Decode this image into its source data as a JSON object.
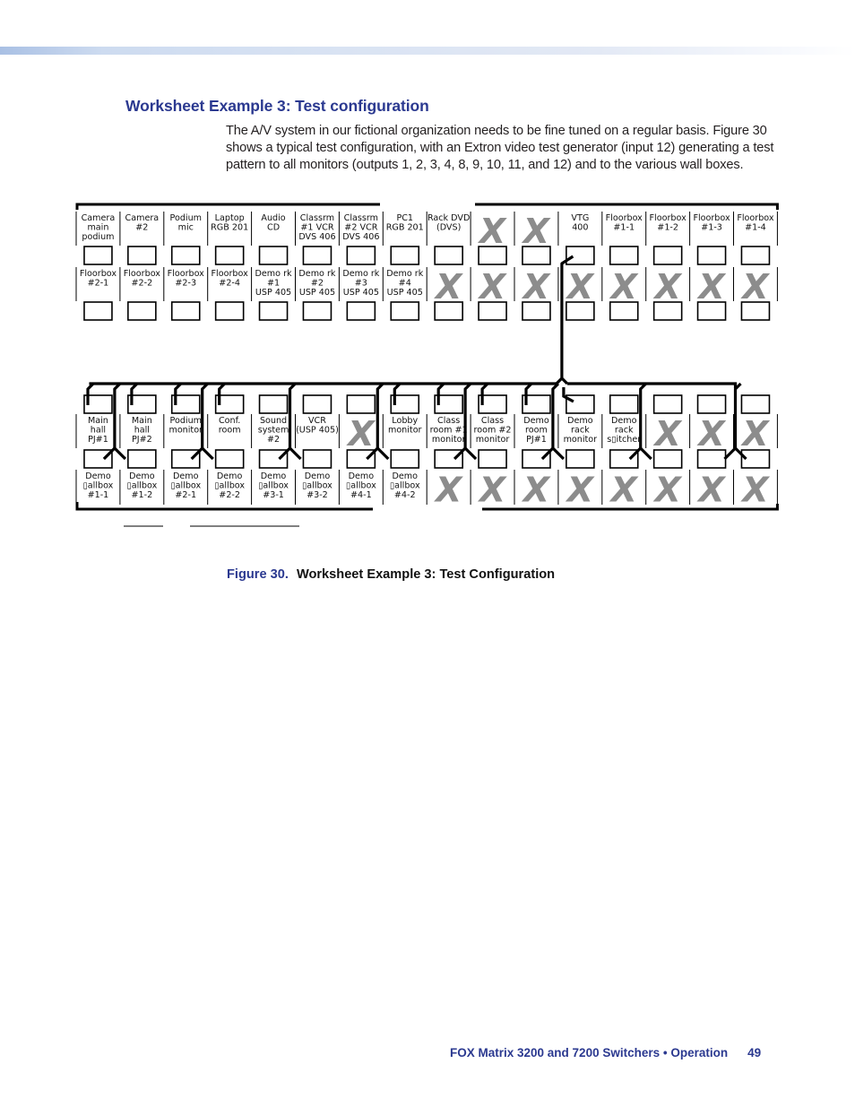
{
  "page": {
    "section_title": "Worksheet Example 3: Test configuration",
    "intro_text": "The A/V system in our fictional organization needs to be fine tuned on a regular basis. Figure 30 shows a typical test configuration, with an Extron video test generator (input 12) generating a test pattern to all monitors (outputs 1, 2, 3, 4, 8, 9, 10, 11, and 12) and to the various wall boxes.",
    "figure_number": "Figure 30.",
    "figure_title": "Worksheet Example 3: Test Configuration",
    "footer_title": "FOX Matrix 3200 and 7200 Switchers • Operation",
    "page_number": "49"
  },
  "diagram": {
    "unused_mark": "X",
    "unused_color": "#8c8c8c",
    "line_color": "#000000",
    "inputs_row1": [
      [
        "Camera",
        "main",
        "podium"
      ],
      [
        "Camera",
        "#2"
      ],
      [
        "Podium",
        "mic"
      ],
      [
        "Laptop",
        "RGB 201"
      ],
      [
        "Audio",
        "CD"
      ],
      [
        "Classrm",
        "#1 VCR",
        "DVS 406"
      ],
      [
        "Classrm",
        "#2 VCR",
        "DVS 406"
      ],
      [
        "PC1",
        "RGB 201"
      ],
      [
        "Rack DVD",
        "(DVS)"
      ],
      null,
      null,
      [
        "VTG",
        "400"
      ],
      [
        "Floorbox",
        "#1-1"
      ],
      [
        "Floorbox",
        "#1-2"
      ],
      [
        "Floorbox",
        "#1-3"
      ],
      [
        "Floorbox",
        "#1-4"
      ]
    ],
    "inputs_row2": [
      [
        "Floorbox",
        "#2-1"
      ],
      [
        "Floorbox",
        "#2-2"
      ],
      [
        "Floorbox",
        "#2-3"
      ],
      [
        "Floorbox",
        "#2-4"
      ],
      [
        "Demo rk",
        "#1",
        "USP 405"
      ],
      [
        "Demo rk",
        "#2",
        "USP 405"
      ],
      [
        "Demo rk",
        "#3",
        "USP 405"
      ],
      [
        "Demo rk",
        "#4",
        "USP 405"
      ],
      null,
      null,
      null,
      null,
      null,
      null,
      null,
      null
    ],
    "outputs_row1": [
      [
        "Main",
        "hall",
        "PJ#1"
      ],
      [
        "Main",
        "hall",
        "PJ#2"
      ],
      [
        "Podium",
        "monitor"
      ],
      [
        "Conf.",
        "room"
      ],
      [
        "Sound",
        "system",
        "#2"
      ],
      [
        "VCR",
        "(USP 405)"
      ],
      null,
      [
        "Lobby",
        "monitor"
      ],
      [
        "Class",
        "room #1",
        "monitor"
      ],
      [
        "Class",
        "room #2",
        "monitor"
      ],
      [
        "Demo",
        "room",
        "PJ#1"
      ],
      [
        "Demo",
        "rack",
        "monitor"
      ],
      [
        "Demo",
        "rack",
        "s▯itcher"
      ],
      null,
      null,
      null
    ],
    "outputs_row2": [
      [
        "Demo",
        "▯allbox",
        "#1-1"
      ],
      [
        "Demo",
        "▯allbox",
        "#1-2"
      ],
      [
        "Demo",
        "▯allbox",
        "#2-1"
      ],
      [
        "Demo",
        "▯allbox",
        "#2-2"
      ],
      [
        "Demo",
        "▯allbox",
        "#3-1"
      ],
      [
        "Demo",
        "▯allbox",
        "#3-2"
      ],
      [
        "Demo",
        "▯allbox",
        "#4-1"
      ],
      [
        "Demo",
        "▯allbox",
        "#4-2"
      ],
      null,
      null,
      null,
      null,
      null,
      null,
      null,
      null
    ],
    "tie": {
      "source_input": 12,
      "output_columns_top": [
        1,
        2,
        3,
        4,
        8,
        9,
        10,
        11,
        12
      ],
      "fork_pairs": [
        [
          1,
          2
        ],
        [
          3,
          4
        ],
        [
          5,
          6
        ],
        [
          7,
          8
        ],
        [
          9,
          10
        ],
        [
          11,
          12
        ],
        [
          13,
          14
        ],
        [
          15,
          16
        ]
      ]
    }
  }
}
